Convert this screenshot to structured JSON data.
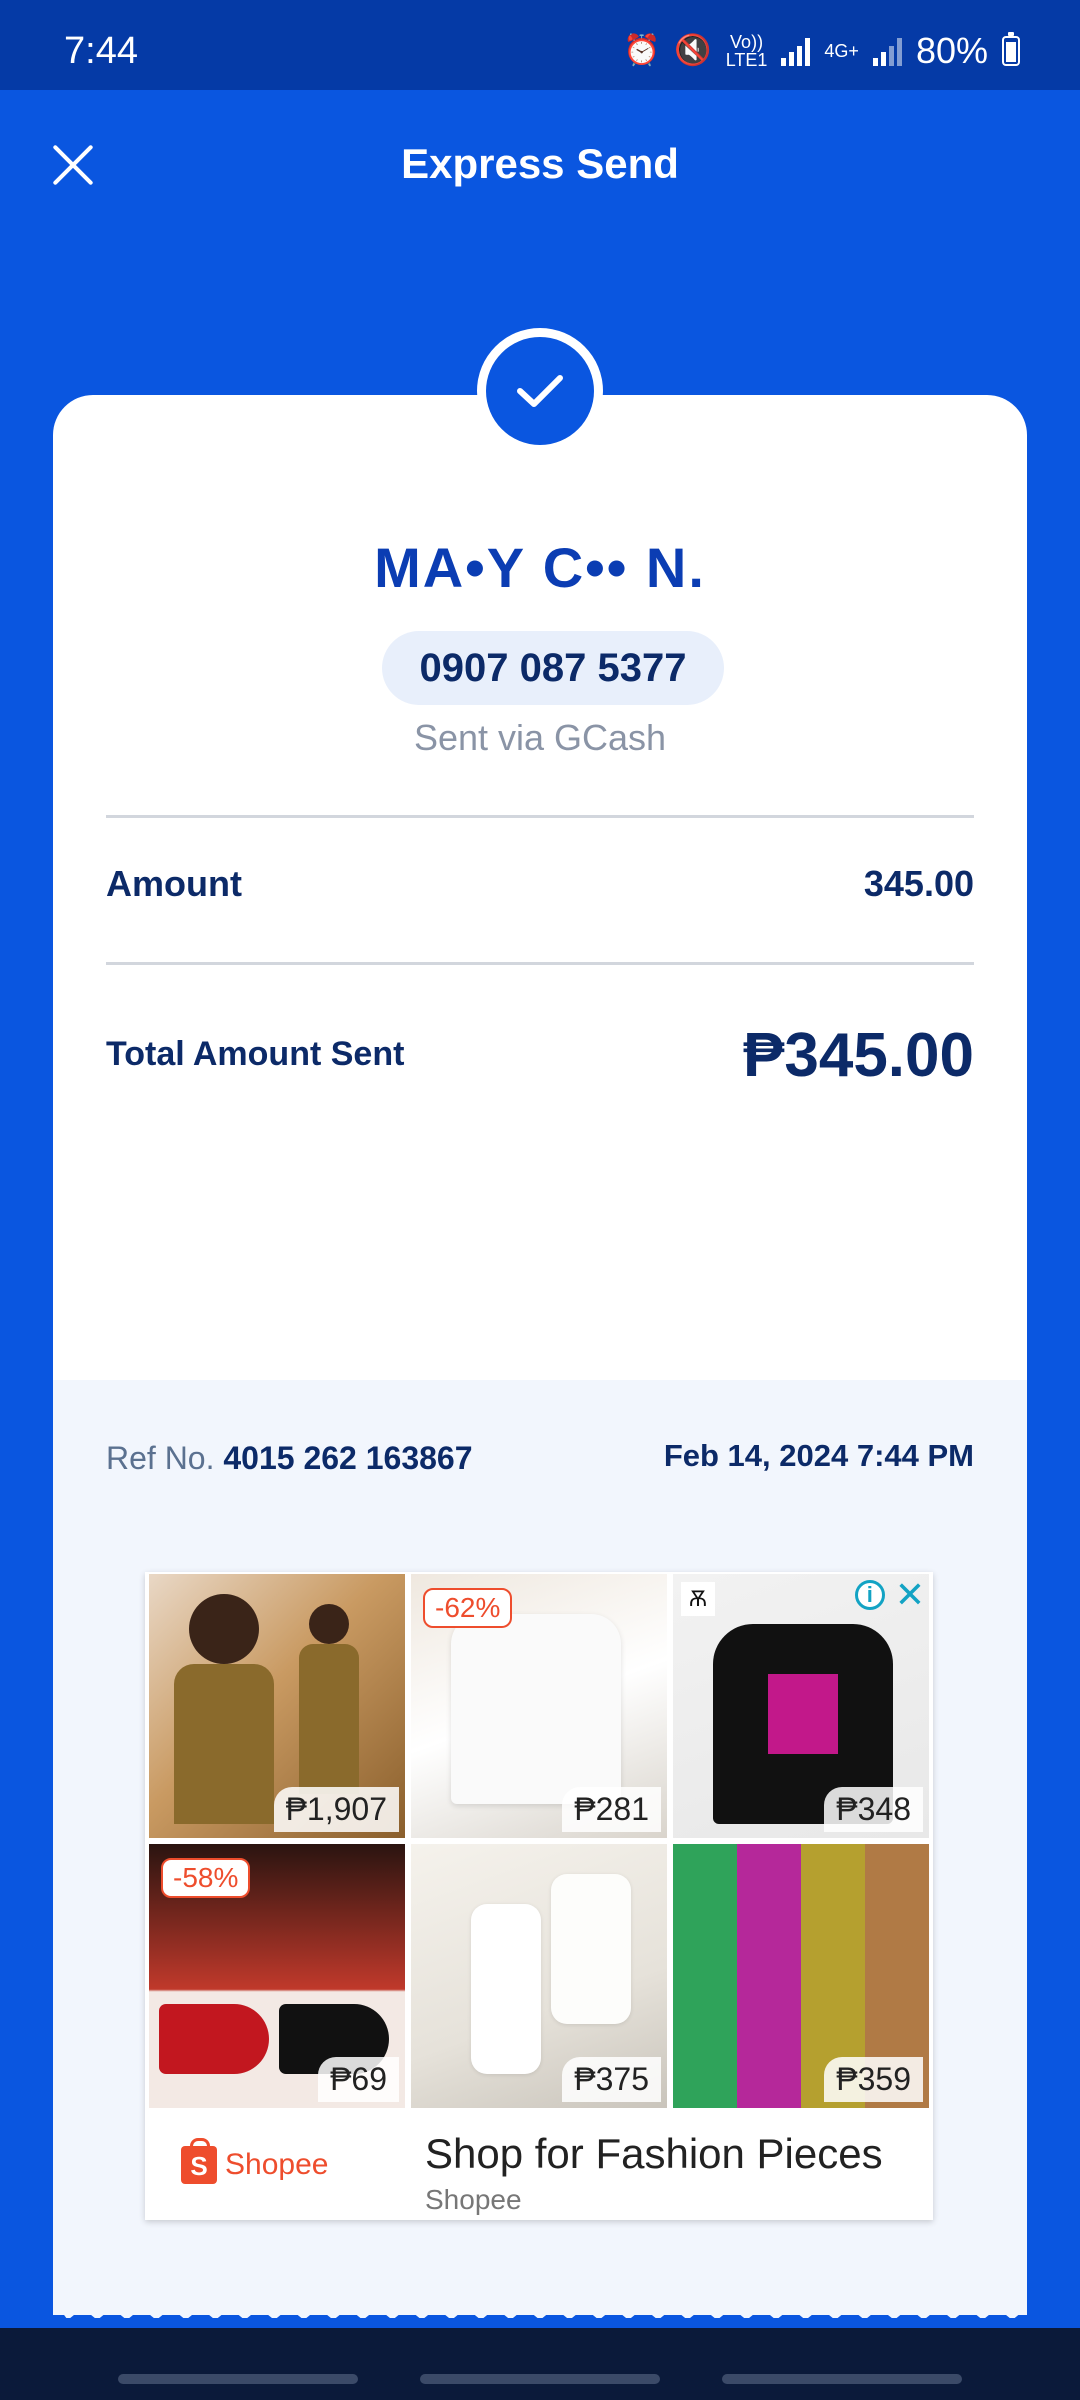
{
  "status_bar": {
    "time": "7:44",
    "network_top": "Vo))",
    "network_bottom": "LTE1",
    "network2_top": "4G+",
    "battery": "80%"
  },
  "header": {
    "title": "Express Send"
  },
  "recipient": {
    "name": "MA•Y C•• N.",
    "phone": "0907 087 5377",
    "sent_via": "Sent via GCash"
  },
  "details": {
    "amount_label": "Amount",
    "amount_value": "345.00",
    "total_label": "Total Amount Sent",
    "total_value": "₱345.00"
  },
  "reference": {
    "ref_label": "Ref No.",
    "ref_number": "4015 262 163867",
    "date": "Feb 14, 2024 7:44 PM"
  },
  "ad": {
    "info_icon": "i",
    "close_icon": "✕",
    "tiles": [
      {
        "price": "₱1,907",
        "discount": ""
      },
      {
        "price": "₱281",
        "discount": "-62%"
      },
      {
        "price": "₱348",
        "discount": ""
      },
      {
        "price": "₱69",
        "discount": "-58%"
      },
      {
        "price": "₱375",
        "discount": ""
      },
      {
        "price": "₱359",
        "discount": ""
      }
    ],
    "brand_logo_text": "Shopee",
    "headline": "Shop for Fashion Pieces",
    "advertiser": "Shopee"
  },
  "colors": {
    "primary_blue": "#0a56e0",
    "text_navy": "#0c2a68",
    "shopee_orange": "#ee4d2d"
  }
}
